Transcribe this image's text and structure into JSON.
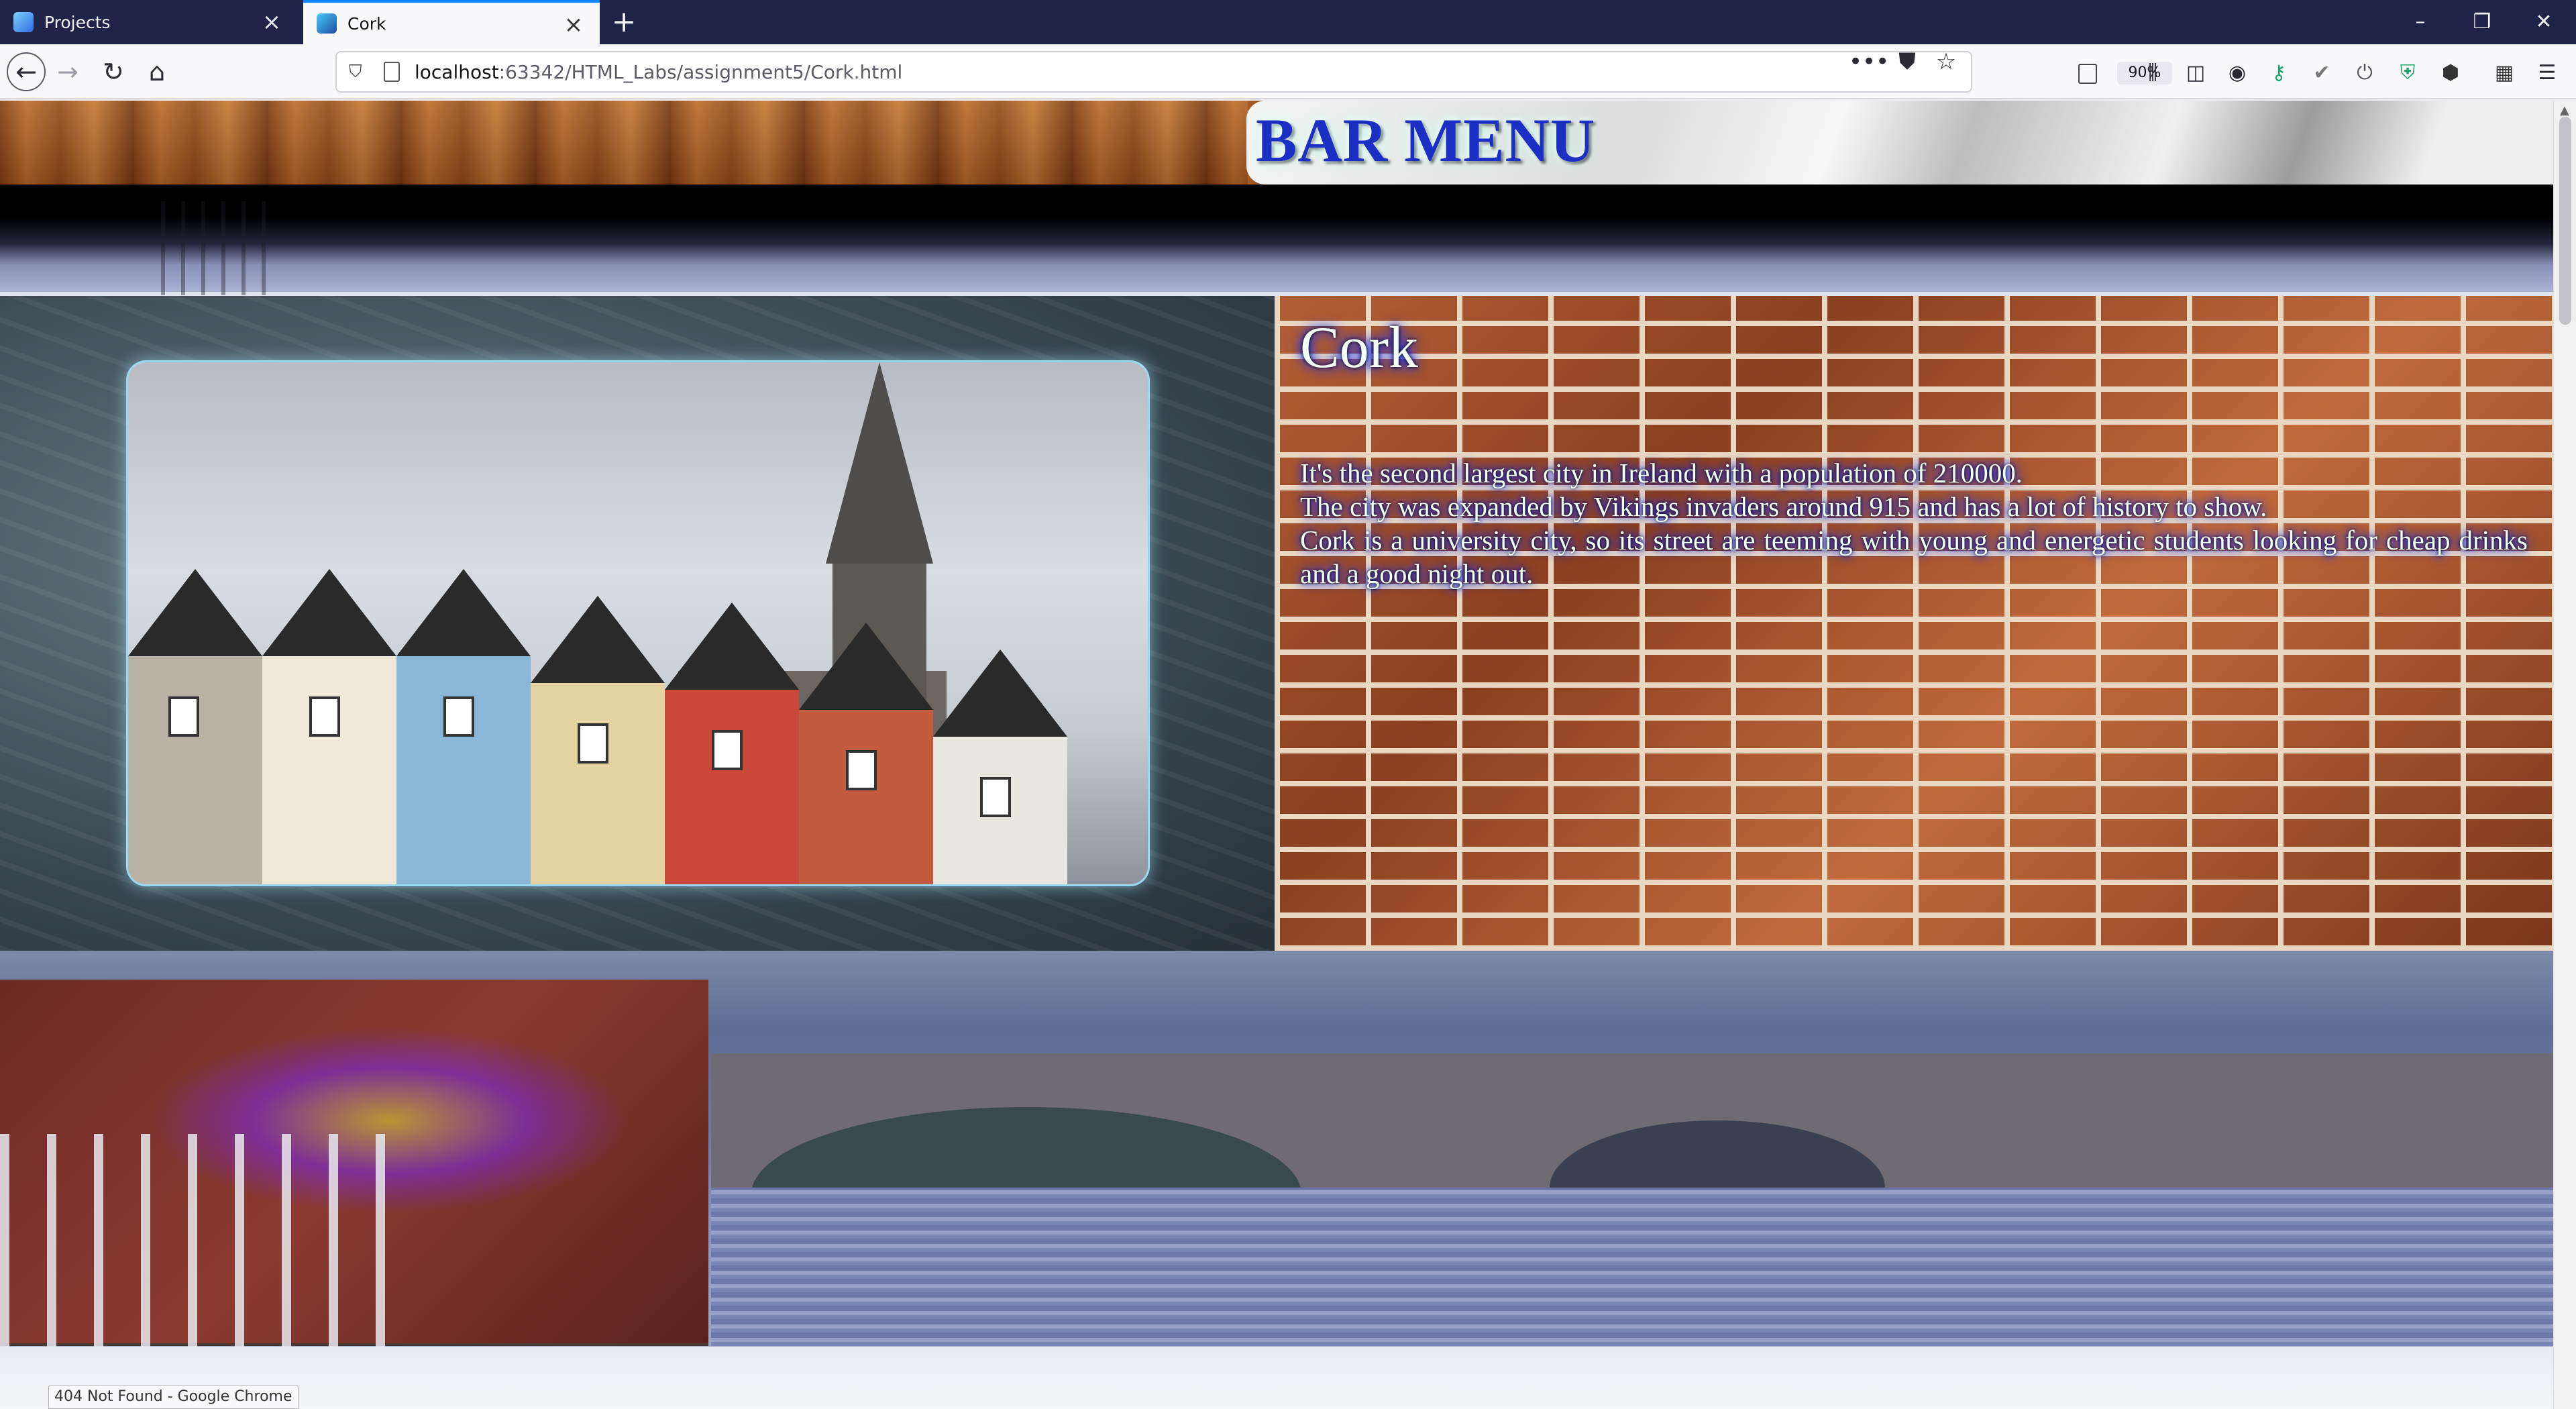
{
  "browser": {
    "tabs": [
      {
        "label": "Projects",
        "active": false
      },
      {
        "label": "Cork",
        "active": true
      }
    ],
    "url": {
      "host": "localhost",
      "rest": ":63342/HTML_Labs/assignment5/Cork.html"
    },
    "zoom": "90%",
    "status_bubble": "404 Not Found - Google Chrome",
    "window_controls": {
      "minimize": "–",
      "restore": "❐",
      "close": "✕"
    },
    "overflow_label": "•••"
  },
  "page": {
    "header_title": "BAR MENU",
    "city_title": "Cork",
    "city_paragraphs": [
      "It's the second largest city in Ireland with a population of 210000.",
      "The city was expanded by Vikings invaders around 915 and has a lot of history to show.",
      "Cork is a university city, so its street are teeming with young and energetic students looking for cheap drinks and a good night out."
    ]
  },
  "colors": {
    "tabbar": "#1f2347",
    "accent": "#0a84ff",
    "header_title": "#1c2fc4",
    "text_glow": "#1530ff"
  },
  "icons": [
    "back-icon",
    "forward-icon",
    "reload-icon",
    "home-icon",
    "shield-icon",
    "page-icon",
    "reader-icon",
    "more-icon",
    "pocket-icon",
    "bookmark-star-icon",
    "library-icon",
    "sidebar-icon",
    "account-icon",
    "extension-icon",
    "menu-icon"
  ]
}
